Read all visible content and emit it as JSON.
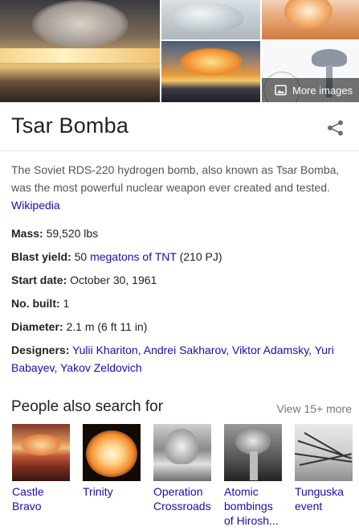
{
  "gallery": {
    "more_images_label": "More images",
    "more_images_icon": "image-gallery-icon"
  },
  "title": "Tsar Bomba",
  "share_icon": "share-icon",
  "description": {
    "text": "The Soviet RDS-220 hydrogen bomb, also known as Tsar Bomba, was the most powerful nuclear weapon ever created and tested.",
    "source": "Wikipedia"
  },
  "facts": {
    "mass": {
      "label": "Mass:",
      "value": "59,520 lbs"
    },
    "blast_yield": {
      "label": "Blast yield:",
      "prefix": "50",
      "link": "megatons of TNT",
      "suffix": "(210 PJ)"
    },
    "start_date": {
      "label": "Start date:",
      "value": "October 30, 1961"
    },
    "no_built": {
      "label": "No. built:",
      "value": "1"
    },
    "diameter": {
      "label": "Diameter:",
      "value": "2.1 m (6 ft 11 in)"
    },
    "designers": {
      "label": "Designers:",
      "names": [
        "Yulii Khariton",
        "Andrei Sakharov",
        "Viktor Adamsky",
        "Yuri Babayev",
        "Yakov Zeldovich"
      ],
      "sep": ","
    }
  },
  "people_also_search": {
    "heading": "People also search for",
    "view_more": "View 15+ more",
    "items": [
      {
        "label": "Castle Bravo"
      },
      {
        "label": "Trinity"
      },
      {
        "label": "Operation Crossroads"
      },
      {
        "label": "Atomic bombings of Hirosh..."
      },
      {
        "label": "Tunguska event"
      }
    ]
  }
}
